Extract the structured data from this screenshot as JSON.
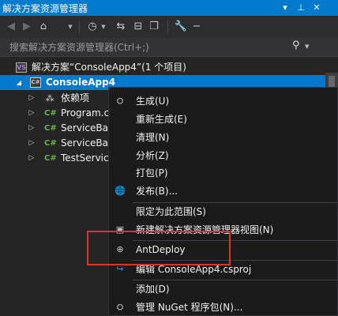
{
  "window": {
    "title": "解决方案资源管理器",
    "buttons": {
      "dropdown": "▾",
      "pin": "⊥",
      "close": "✕"
    }
  },
  "toolbar": {
    "icons": [
      "back-icon",
      "forward-icon",
      "home-icon",
      "dropdown-icon",
      "history-icon",
      "dropdown-icon",
      "sync-icon",
      "collapse-all-icon",
      "copy-icon",
      "properties-wrench-icon",
      "minus-icon"
    ]
  },
  "search": {
    "placeholder": "搜索解决方案资源管理器(Ctrl+;)",
    "icon": "search-icon"
  },
  "tree": {
    "solution_label": "解决方案“ConsoleApp4”(1 个项目)",
    "project_label": "ConsoleApp4",
    "items": [
      {
        "label": "依赖项",
        "icon": "dependencies-icon"
      },
      {
        "label": "Program.c",
        "icon": "csharp-file-icon"
      },
      {
        "label": "ServiceBas",
        "icon": "csharp-file-icon"
      },
      {
        "label": "ServiceBas",
        "icon": "csharp-file-icon"
      },
      {
        "label": "TestServic",
        "icon": "csharp-file-icon"
      }
    ],
    "cs_glyph": "C#"
  },
  "context_menu": {
    "items": [
      {
        "label": "生成(U)",
        "icon": "build-icon"
      },
      {
        "label": "重新生成(E)",
        "icon": ""
      },
      {
        "label": "清理(N)",
        "icon": ""
      },
      {
        "label": "分析(Z)",
        "icon": ""
      },
      {
        "label": "打包(P)",
        "icon": ""
      },
      {
        "label": "发布(B)...",
        "icon": "publish-globe-icon"
      },
      {
        "label": "限定为此范围(S)",
        "icon": ""
      },
      {
        "label": "新建解决方案资源管理器视图(N)",
        "icon": "new-view-icon"
      },
      {
        "label": "AntDeploy",
        "icon": "antdeploy-globe-icon"
      },
      {
        "label": "编辑 ConsoleApp4.csproj",
        "icon": "edit-arrow-icon"
      },
      {
        "label": "添加(D)",
        "icon": ""
      },
      {
        "label": "管理 NuGet 程序包(N)...",
        "icon": "nuget-icon"
      }
    ]
  },
  "colors": {
    "accent": "#007acc",
    "highlight_box": "#e0342b",
    "menu_bg": "#1b1b1c",
    "panel_bg": "#252526"
  }
}
